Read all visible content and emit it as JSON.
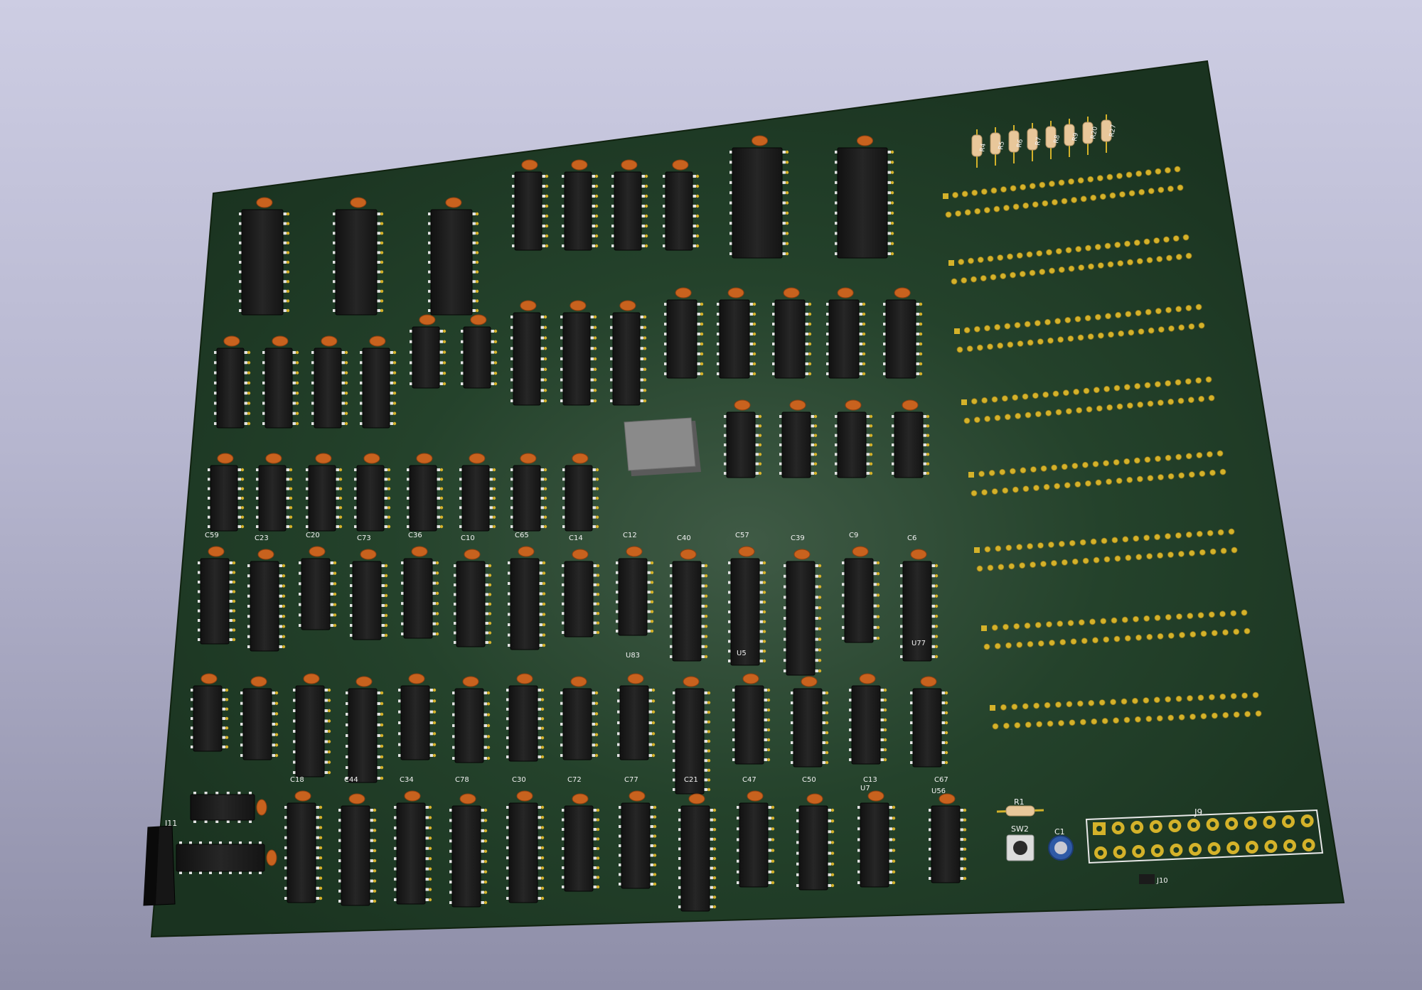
{
  "viewer": {
    "background_top": "#cdcde3",
    "background_bottom": "#8e8ea8",
    "board_color": "#1d3a22",
    "chip_color": "#1b1b1b",
    "capacitor_color": "#c8621e",
    "pad_color": "#d4b22a"
  },
  "board": {
    "labels": {
      "edge_connector": "J11",
      "pin_header": "J9",
      "resistor": "R1",
      "switch": "SW2",
      "electrolytic_cap": "C1",
      "jumper": "J10"
    },
    "resistor_array_labels": [
      "R4",
      "R5",
      "R6",
      "R7",
      "R8",
      "R9",
      "R20",
      "R27"
    ],
    "capacitor_labels_row5": [
      "C59",
      "C23",
      "C20",
      "C73",
      "C36",
      "C10",
      "C65",
      "C14",
      "C12",
      "C40",
      "C57",
      "C39",
      "C9",
      "C6"
    ],
    "capacitor_labels_row6": [
      "C18",
      "C44",
      "C34",
      "C78",
      "C30",
      "C72",
      "C77",
      "C21",
      "C47",
      "C50",
      "C13",
      "C67"
    ],
    "chip_labels_row5": [
      "U83",
      "U5",
      "U77"
    ],
    "chip_labels_row6": [
      "U56",
      "U7"
    ]
  }
}
